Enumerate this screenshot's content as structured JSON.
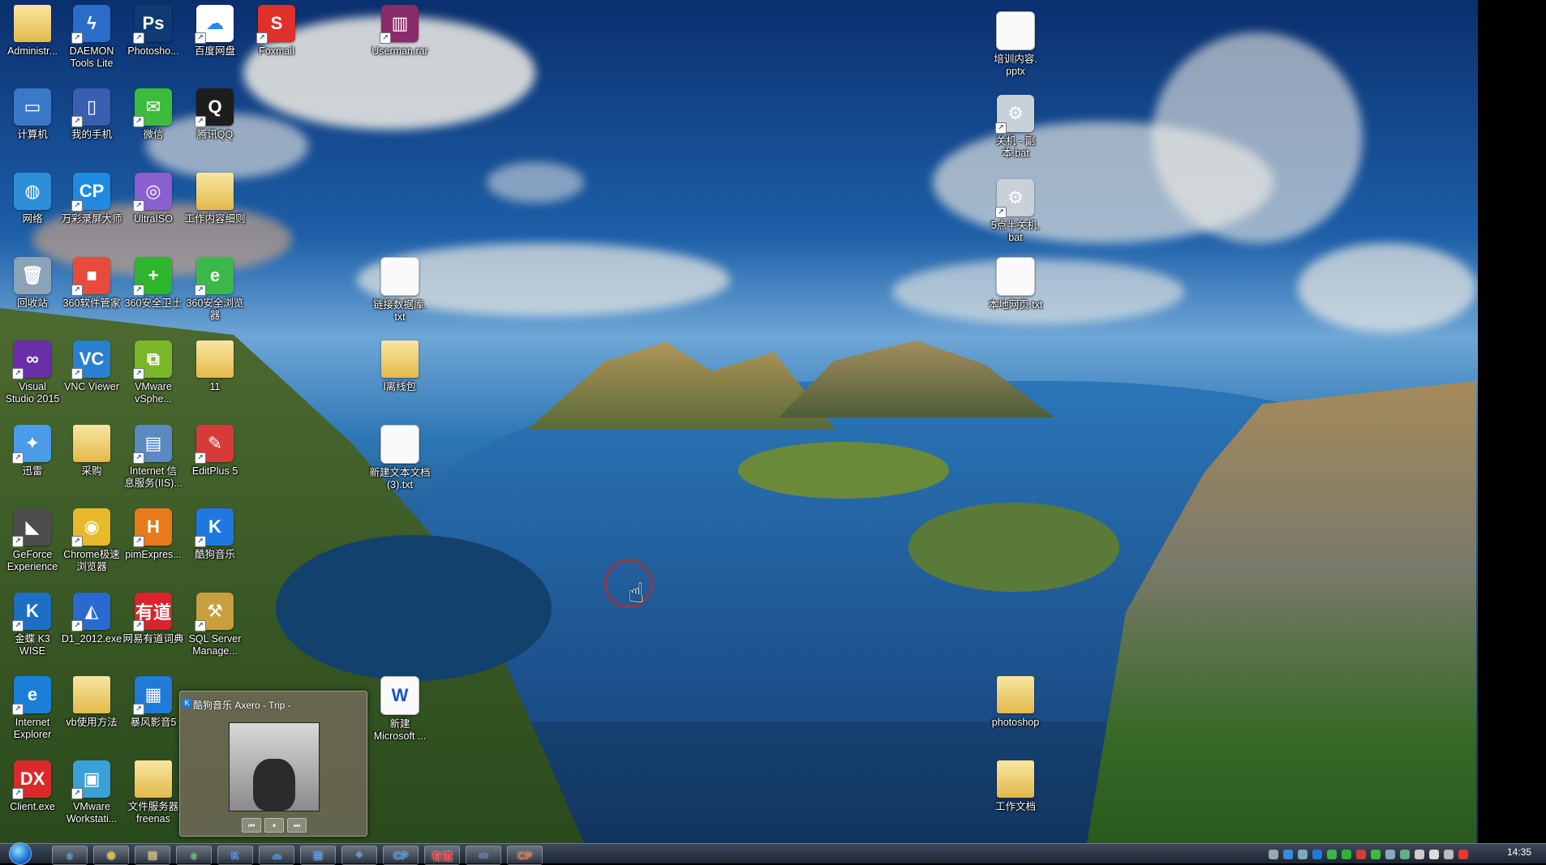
{
  "desktop": {
    "icons": [
      {
        "label": "Administr...",
        "kind": "folder",
        "color": "#e3b94a",
        "glyph": ""
      },
      {
        "label": "计算机",
        "kind": "app",
        "color": "#3a78c8",
        "glyph": "▭"
      },
      {
        "label": "网络",
        "kind": "app",
        "color": "#2e8fd8",
        "glyph": "◍"
      },
      {
        "label": "回收站",
        "kind": "app",
        "color": "#8aa3b8",
        "glyph": "🗑"
      },
      {
        "label": "Visual\nStudio 2015",
        "kind": "app",
        "color": "#6a2fa8",
        "glyph": "∞"
      },
      {
        "label": "迅雷",
        "kind": "app",
        "color": "#4a9be8",
        "glyph": "✦"
      },
      {
        "label": "GeForce\nExperience",
        "kind": "app",
        "color": "#4d4d4d",
        "glyph": "◣"
      },
      {
        "label": "金蝶 K3\nWISE",
        "kind": "app",
        "color": "#1d6fc4",
        "glyph": "K"
      },
      {
        "label": "Internet\nExplorer",
        "kind": "app",
        "color": "#1b7fd8",
        "glyph": "e"
      },
      {
        "label": "Client.exe",
        "kind": "app",
        "color": "#d82a2a",
        "glyph": "DX"
      },
      {
        "label": "DAEMON\nTools Lite",
        "kind": "app",
        "color": "#2a6cc8",
        "glyph": "ϟ"
      },
      {
        "label": "我的手机",
        "kind": "app",
        "color": "#3a5fb0",
        "glyph": "▯"
      },
      {
        "label": "万彩录屏大师",
        "kind": "app",
        "color": "#1f8ae0",
        "glyph": "CP"
      },
      {
        "label": "360软件管家",
        "kind": "app",
        "color": "#e84b3b",
        "glyph": "■"
      },
      {
        "label": "VNC Viewer",
        "kind": "app",
        "color": "#2a7fd0",
        "glyph": "VC"
      },
      {
        "label": "采购",
        "kind": "folder",
        "color": "#e3b94a",
        "glyph": ""
      },
      {
        "label": "Chrome极速\n浏览器",
        "kind": "app",
        "color": "#e8b92a",
        "glyph": "◉"
      },
      {
        "label": "D1_2012.exe",
        "kind": "app",
        "color": "#2a6ad0",
        "glyph": "◭"
      },
      {
        "label": "vb使用方法",
        "kind": "folder",
        "color": "#e3b94a",
        "glyph": ""
      },
      {
        "label": "VMware\nWorkstati...",
        "kind": "app",
        "color": "#3aa0d8",
        "glyph": "▣"
      },
      {
        "label": "Photosho...",
        "kind": "app",
        "color": "#0f3a72",
        "glyph": "Ps"
      },
      {
        "label": "微信",
        "kind": "app",
        "color": "#3cbc3c",
        "glyph": "✉"
      },
      {
        "label": "UltraISO",
        "kind": "app",
        "color": "#8a5fd0",
        "glyph": "◎"
      },
      {
        "label": "360安全卫士",
        "kind": "app",
        "color": "#2db52d",
        "glyph": "+"
      },
      {
        "label": "VMware\nvSphe...",
        "kind": "app",
        "color": "#7ab82a",
        "glyph": "⧉"
      },
      {
        "label": "Internet 信\n息服务(IIS)...",
        "kind": "app",
        "color": "#5a8ac0",
        "glyph": "▤"
      },
      {
        "label": "pimExpres...",
        "kind": "app",
        "color": "#e87a1a",
        "glyph": "H"
      },
      {
        "label": "网易有道词典",
        "kind": "app",
        "color": "#d8242a",
        "glyph": "有道"
      },
      {
        "label": "暴风影音5",
        "kind": "app",
        "color": "#1f7ad8",
        "glyph": "▦"
      },
      {
        "label": "文件服务器\nfreenas",
        "kind": "folder",
        "color": "#e3b94a",
        "glyph": ""
      },
      {
        "label": "百度网盘",
        "kind": "app",
        "color": "#ffffff",
        "glyph": "☁"
      },
      {
        "label": "腾讯QQ",
        "kind": "app",
        "color": "#1d1d1d",
        "glyph": "Q"
      },
      {
        "label": "工作内容细则",
        "kind": "folder",
        "color": "#e3b94a",
        "glyph": ""
      },
      {
        "label": "360安全浏览\n器",
        "kind": "app",
        "color": "#3cb84a",
        "glyph": "e"
      },
      {
        "label": "11",
        "kind": "folder",
        "color": "#e3b94a",
        "glyph": ""
      },
      {
        "label": "EditPlus 5",
        "kind": "app",
        "color": "#d83a3a",
        "glyph": "✎"
      },
      {
        "label": "酷狗音乐",
        "kind": "app",
        "color": "#1e78e0",
        "glyph": "K"
      },
      {
        "label": "SQL Server\nManage...",
        "kind": "app",
        "color": "#c8a040",
        "glyph": "⚒"
      },
      {
        "label": "Foxmail",
        "kind": "app",
        "color": "#e0302a",
        "glyph": "S"
      },
      {
        "label": "Userman.rar",
        "kind": "app",
        "color": "#8a2a6a",
        "glyph": "▥"
      },
      {
        "label": "链接数据库.\ntxt",
        "kind": "doc",
        "color": "#fafafa",
        "glyph": ""
      },
      {
        "label": "l离线包",
        "kind": "folder",
        "color": "#e3b94a",
        "glyph": ""
      },
      {
        "label": "新建文本文档\n(3).txt",
        "kind": "doc",
        "color": "#fafafa",
        "glyph": ""
      },
      {
        "label": "新建\nMicrosoft ...",
        "kind": "doc",
        "color": "#dce8f8",
        "glyph": "W"
      },
      {
        "label": "培训内容.\npptx",
        "kind": "doc",
        "color": "#fafafa",
        "glyph": ""
      },
      {
        "label": "关机 - 副\n本.bat",
        "kind": "app",
        "color": "#c8d0d8",
        "glyph": "⚙"
      },
      {
        "label": "5点半关机.\nbat",
        "kind": "app",
        "color": "#c8d0d8",
        "glyph": "⚙"
      },
      {
        "label": "本地网页.txt",
        "kind": "doc",
        "color": "#fafafa",
        "glyph": ""
      },
      {
        "label": "photoshop",
        "kind": "folder",
        "color": "#e3b94a",
        "glyph": ""
      },
      {
        "label": "工作文档",
        "kind": "folder",
        "color": "#e3b94a",
        "glyph": ""
      }
    ]
  },
  "music_popup": {
    "title": "酷狗音乐 Axero - Trip -",
    "controls": [
      "⏮",
      "⏸",
      "⏭"
    ]
  },
  "taskbar": {
    "buttons": [
      {
        "name": "ie",
        "glyph": "e",
        "color": "#1b7fd8"
      },
      {
        "name": "chrome",
        "glyph": "◉",
        "color": "#e8b92a"
      },
      {
        "name": "explorer",
        "glyph": "▤",
        "color": "#e3b94a"
      },
      {
        "name": "360-browser",
        "glyph": "e",
        "color": "#3cb84a"
      },
      {
        "name": "kugou",
        "glyph": "K",
        "color": "#1e78e0"
      },
      {
        "name": "baidu-netdisk",
        "glyph": "☁",
        "color": "#2a8ae0"
      },
      {
        "name": "storm",
        "glyph": "▦",
        "color": "#1f7ad8"
      },
      {
        "name": "xunlei",
        "glyph": "✦",
        "color": "#4a9be8"
      },
      {
        "name": "cp",
        "glyph": "CP",
        "color": "#1f8ae0"
      },
      {
        "name": "youdao",
        "glyph": "有道",
        "color": "#d8242a"
      },
      {
        "name": "computer",
        "glyph": "▭",
        "color": "#3a78c8"
      },
      {
        "name": "cp-red",
        "glyph": "CP",
        "color": "#e05a2a"
      }
    ],
    "clock": "14:35"
  }
}
